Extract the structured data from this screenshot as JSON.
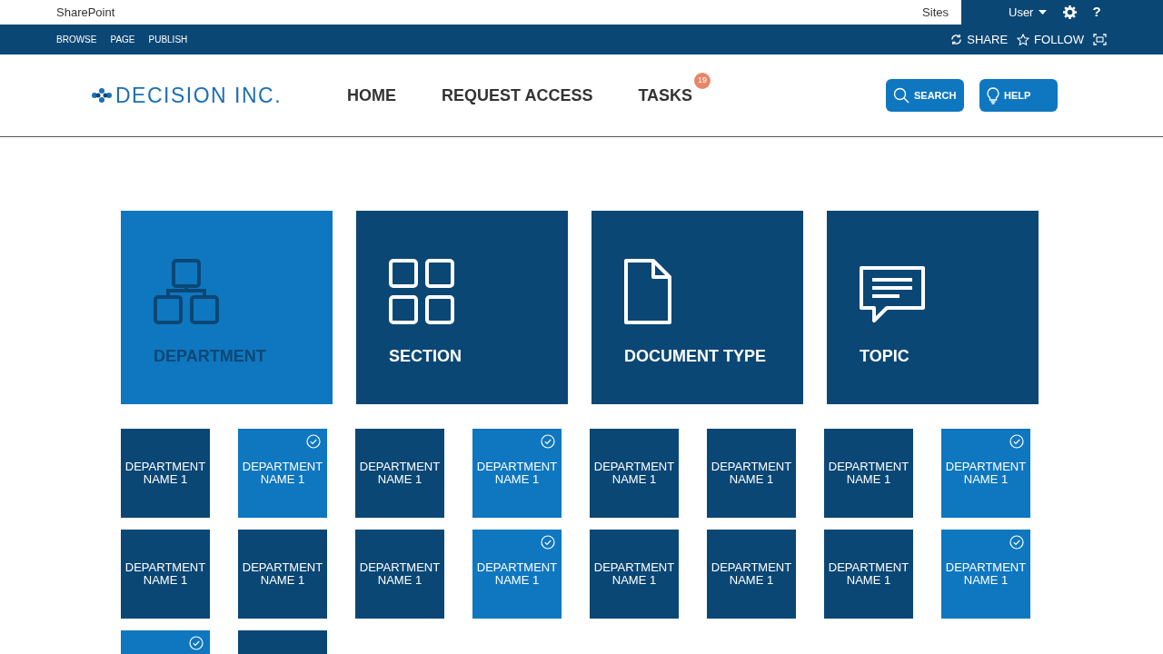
{
  "suite_bar": {
    "brand": "SharePoint",
    "sites_link": "Sites",
    "user": "User",
    "help": "?"
  },
  "ribbon": {
    "tabs": [
      {
        "label": "BROWSE"
      },
      {
        "label": "PAGE"
      },
      {
        "label": "PUBLISH"
      }
    ],
    "actions": [
      {
        "label": "SHARE",
        "kind": "share"
      },
      {
        "label": "FOLLOW",
        "kind": "follow"
      }
    ]
  },
  "header": {
    "logo": "DECISION INC.",
    "nav": [
      {
        "label": "HOME"
      },
      {
        "label": "REQUEST ACCESS"
      },
      {
        "label": "TASKS",
        "badge": "19"
      }
    ],
    "buttons": [
      {
        "label": "SEARCH",
        "kind": "search"
      },
      {
        "label": "HELP",
        "kind": "help"
      }
    ]
  },
  "categories": [
    {
      "label": "DEPARTMENT",
      "kind": "department",
      "selected": true
    },
    {
      "label": "SECTION",
      "kind": "section",
      "selected": false
    },
    {
      "label": "DOCUMENT TYPE",
      "kind": "document",
      "selected": false
    },
    {
      "label": "TOPIC",
      "kind": "topic",
      "selected": false
    }
  ],
  "departments": [
    {
      "label": "DEPARTMENT NAME 1",
      "selected": false
    },
    {
      "label": "DEPARTMENT NAME 1",
      "selected": true
    },
    {
      "label": "DEPARTMENT NAME 1",
      "selected": false
    },
    {
      "label": "DEPARTMENT NAME 1",
      "selected": true
    },
    {
      "label": "DEPARTMENT NAME 1",
      "selected": false
    },
    {
      "label": "DEPARTMENT NAME 1",
      "selected": false
    },
    {
      "label": "DEPARTMENT NAME 1",
      "selected": false
    },
    {
      "label": "DEPARTMENT NAME 1",
      "selected": true
    },
    {
      "label": "DEPARTMENT NAME 1",
      "selected": false
    },
    {
      "label": "DEPARTMENT NAME 1",
      "selected": false
    },
    {
      "label": "DEPARTMENT NAME 1",
      "selected": false
    },
    {
      "label": "DEPARTMENT NAME 1",
      "selected": true
    },
    {
      "label": "DEPARTMENT NAME 1",
      "selected": false
    },
    {
      "label": "DEPARTMENT NAME 1",
      "selected": false
    },
    {
      "label": "DEPARTMENT NAME 1",
      "selected": false
    },
    {
      "label": "DEPARTMENT NAME 1",
      "selected": true
    },
    {
      "selected": true
    },
    {
      "selected": false
    }
  ]
}
